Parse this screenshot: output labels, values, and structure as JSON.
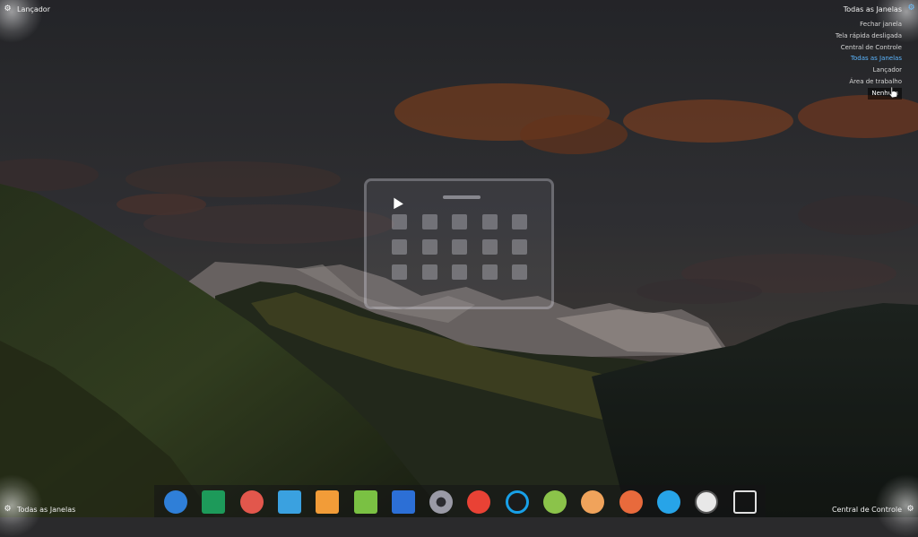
{
  "corners": {
    "top_left": "Lançador",
    "top_right": "Todas as Janelas",
    "bottom_left": "Todas as Janelas",
    "bottom_right": "Central de Controle"
  },
  "hot_corner_menu": {
    "items": [
      {
        "label": "Fechar janela",
        "state": "normal"
      },
      {
        "label": "Tela rápida desligada",
        "state": "normal"
      },
      {
        "label": "Central de Controle",
        "state": "normal"
      },
      {
        "label": "Todas as Janelas",
        "state": "selected"
      },
      {
        "label": "Lançador",
        "state": "normal"
      },
      {
        "label": "Área de trabalho",
        "state": "normal"
      },
      {
        "label": "Nenhum",
        "state": "hover"
      }
    ],
    "selected_color": "#5bb6ff"
  },
  "launcher_widget": {
    "icon": "launcher-grid-icon",
    "rows": 3,
    "cols": 5
  },
  "dock": {
    "items": [
      {
        "name": "app-launcher-icon",
        "color": "#2f7fd8"
      },
      {
        "name": "terminal-icon",
        "color": "#1d9a5a"
      },
      {
        "name": "screenshot-icon",
        "color": "#e2574c"
      },
      {
        "name": "file-manager-icon",
        "color": "#3aa1e0"
      },
      {
        "name": "archive-icon",
        "color": "#f29c38"
      },
      {
        "name": "music-player-icon",
        "color": "#7ac143"
      },
      {
        "name": "video-player-icon",
        "color": "#2c6fd6"
      },
      {
        "name": "settings-gear-icon",
        "color": "#9a9aa6"
      },
      {
        "name": "chrome-browser-icon",
        "color": "#e94235"
      },
      {
        "name": "screen-recorder-icon",
        "color": "#18a0e8"
      },
      {
        "name": "android-icon",
        "color": "#8bc34a"
      },
      {
        "name": "chromium-icon",
        "color": "#f0a35b"
      },
      {
        "name": "eject-icon",
        "color": "#e86a3c"
      },
      {
        "name": "wifi-icon",
        "color": "#27a4e8"
      },
      {
        "name": "clock-icon",
        "color": "#e8e8e8"
      },
      {
        "name": "trash-icon",
        "color": "#e0e0e0"
      }
    ]
  }
}
